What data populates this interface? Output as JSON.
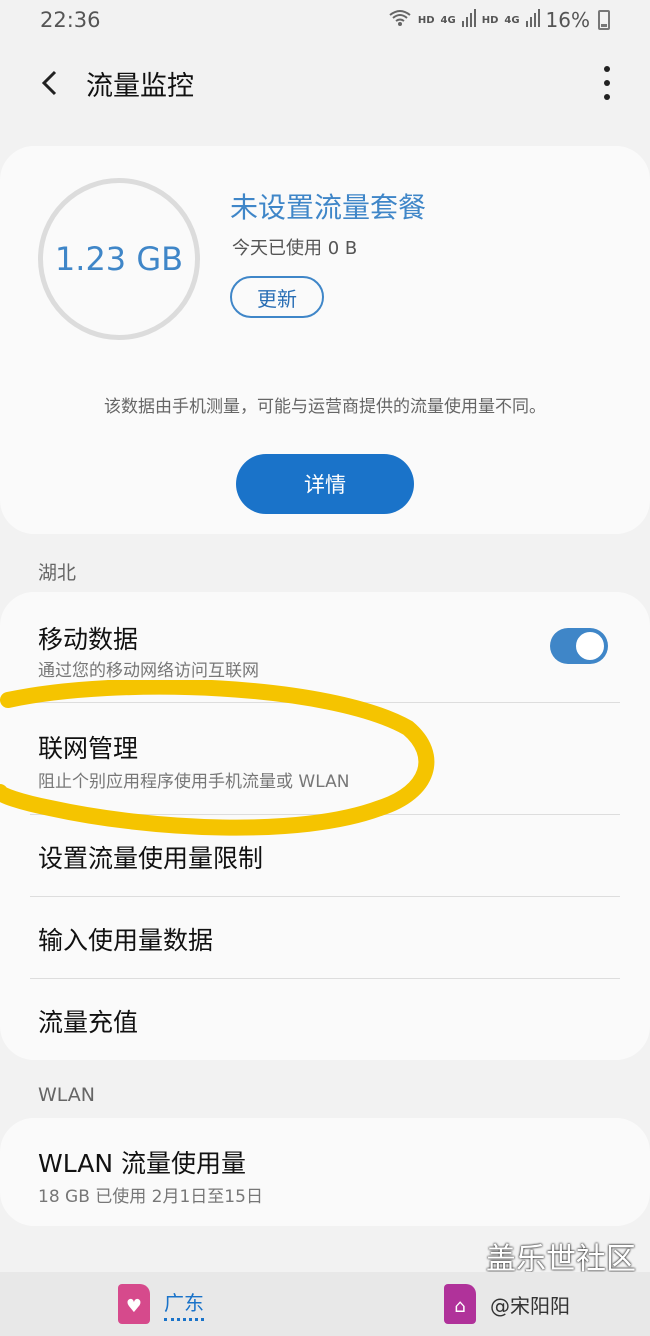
{
  "status": {
    "time": "22:36",
    "network1": "HD",
    "network2": "HD",
    "sig1": "4G",
    "sig2": "4G",
    "battery": "16%"
  },
  "header": {
    "title": "流量监控"
  },
  "usage": {
    "ring_value": "1.23 GB",
    "plan_title": "未设置流量套餐",
    "today": "今天已使用 0 B",
    "refresh_label": "更新",
    "disclaimer": "该数据由手机测量，可能与运营商提供的流量使用量不同。",
    "details_label": "详情"
  },
  "sim_section": {
    "label": "湖北"
  },
  "settings": [
    {
      "title": "移动数据",
      "subtitle": "通过您的移动网络访问互联网"
    },
    {
      "title": "联网管理",
      "subtitle": "阻止个别应用程序使用手机流量或 WLAN"
    },
    {
      "title": "设置流量使用量限制"
    },
    {
      "title": "输入使用量数据"
    },
    {
      "title": "流量充值"
    }
  ],
  "mobile_data_on": true,
  "wlan_section": {
    "label": "WLAN"
  },
  "wlan": {
    "title": "WLAN 流量使用量",
    "subtitle": "18 GB 已使用 2月1日至15日"
  },
  "bottom": {
    "sim1_label": "广东",
    "sim2_label": "@宋阳阳"
  },
  "watermark": {
    "line1": "盖乐世社区"
  },
  "colors": {
    "accent": "#1a73c9",
    "link": "#3f86c8",
    "highlight": "#f5c400"
  }
}
